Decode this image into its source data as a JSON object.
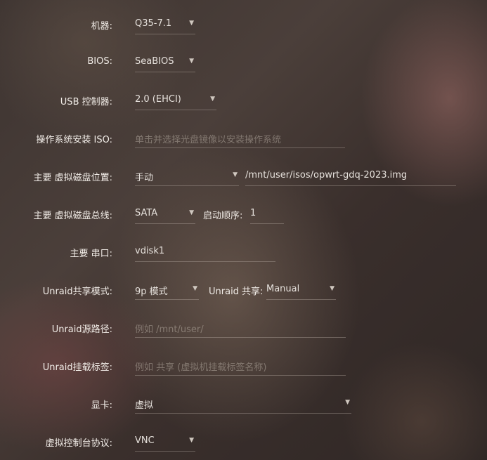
{
  "form": {
    "machine": {
      "label": "机器:",
      "value": "Q35-7.1"
    },
    "bios": {
      "label": "BIOS:",
      "value": "SeaBIOS"
    },
    "usb": {
      "label": "USB 控制器:",
      "value": "2.0 (EHCI)"
    },
    "os_iso": {
      "label": "操作系统安装 ISO:",
      "placeholder": "单击并选择光盘镜像以安装操作系统"
    },
    "vdisk_location": {
      "label": "主要 虚拟磁盘位置:",
      "mode": "手动",
      "path": "/mnt/user/isos/opwrt-gdq-2023.img"
    },
    "vdisk_bus": {
      "label": "主要 虚拟磁盘总线:",
      "value": "SATA",
      "boot_order_label": "启动顺序:",
      "boot_order_value": "1"
    },
    "serial": {
      "label": "主要 串口:",
      "value": "vdisk1"
    },
    "share_mode": {
      "label": "Unraid共享模式:",
      "value": "9p 模式",
      "share_label": "Unraid 共享:",
      "share_value": "Manual"
    },
    "source_path": {
      "label": "Unraid源路径:",
      "placeholder": "例如 /mnt/user/"
    },
    "mount_tag": {
      "label": "Unraid挂载标签:",
      "placeholder": "例如 共享 (虚拟机挂载标签名称)"
    },
    "graphics": {
      "label": "显卡:",
      "value": "虚拟"
    },
    "console_protocol": {
      "label": "虚拟控制台协议:",
      "value": "VNC"
    }
  },
  "icons": {
    "dropdown": "caret-down-icon"
  }
}
